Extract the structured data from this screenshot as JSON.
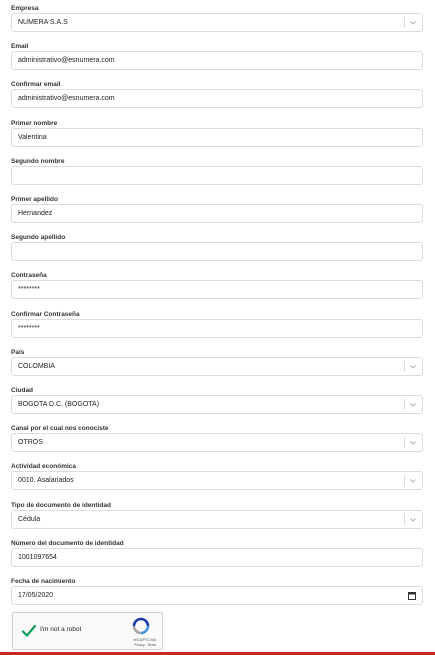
{
  "fields": [
    {
      "id": "empresa",
      "label": "Empresa",
      "type": "select",
      "value": "NUMERA S.A.S"
    },
    {
      "id": "email",
      "label": "Email",
      "type": "text",
      "value": "administrativo@esnumera.com"
    },
    {
      "id": "confirm-email",
      "label": "Confirmar email",
      "type": "text",
      "value": "administrativo@esnumera.com"
    },
    {
      "id": "primer-nombre",
      "label": "Primer nombre",
      "type": "text",
      "value": "Valentina"
    },
    {
      "id": "segundo-nombre",
      "label": "Segundo nombre",
      "type": "text",
      "value": ""
    },
    {
      "id": "primer-apellido",
      "label": "Primer apellido",
      "type": "text",
      "value": "Hernandez"
    },
    {
      "id": "segundo-apellido",
      "label": "Segundo apellido",
      "type": "text",
      "value": ""
    },
    {
      "id": "contrasena",
      "label": "Contraseña",
      "type": "password",
      "value": "********"
    },
    {
      "id": "confirm-contrasena",
      "label": "Confirmar Contraseña",
      "type": "password",
      "value": "********"
    },
    {
      "id": "pais",
      "label": "País",
      "type": "select",
      "value": "COLOMBIA"
    },
    {
      "id": "ciudad",
      "label": "Ciudad",
      "type": "select",
      "value": "BOGOTA D.C. (BOGOTA)"
    },
    {
      "id": "canal",
      "label": "Canal por el cual nos conociste",
      "type": "select",
      "value": "OTROS"
    },
    {
      "id": "actividad",
      "label": "Actividad económica",
      "type": "select",
      "value": "0010. Asalariados"
    },
    {
      "id": "tipo-documento",
      "label": "Tipo de documento de identidad",
      "type": "select",
      "value": "Cédula"
    },
    {
      "id": "numero-documento",
      "label": "Número del documento de identidad",
      "type": "text",
      "value": "1001097654"
    },
    {
      "id": "fecha-nacimiento",
      "label": "Fecha de nacimiento",
      "type": "date",
      "value": "17/05/2020"
    }
  ],
  "captcha": {
    "label": "I'm not a robot",
    "brand": "reCAPTCHA",
    "terms": "Privacy - Terms"
  },
  "colors": {
    "accent": "#c62828",
    "check": "#0f9d58",
    "border": "#dcdcdc"
  }
}
